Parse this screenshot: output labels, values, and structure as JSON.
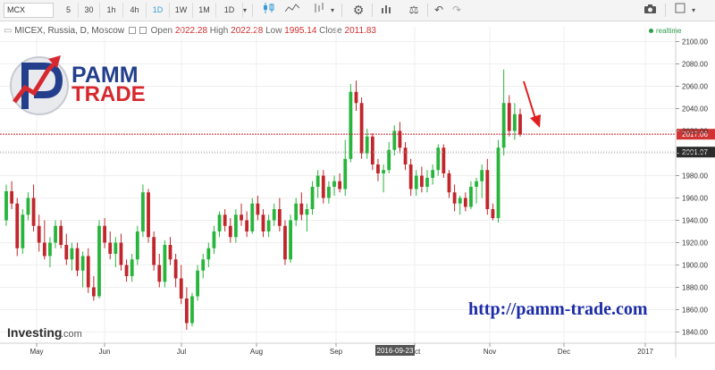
{
  "toolbar": {
    "symbol": "MCX",
    "intervals": [
      "5",
      "30",
      "1h",
      "4h",
      "1D",
      "1W",
      "1M"
    ],
    "active_interval": "1D",
    "range_select": "1D",
    "icons": [
      "candlestick-chart-icon",
      "area-chart-icon",
      "indicators-icon",
      "settings-icon",
      "bar-chart-icon",
      "scale-icon",
      "undo-icon",
      "redo-icon",
      "camera-icon",
      "fullscreen-icon"
    ]
  },
  "legend": {
    "title": "MICEX, Russia, D, Moscow",
    "open_label": "Open",
    "open": "2022.28",
    "high_label": "High",
    "high": "2022.28",
    "low_label": "Low",
    "low": "1995.14",
    "close_label": "Close",
    "close": "2011.83",
    "realtime": "realtime"
  },
  "branding": {
    "logo_line1": "PAMM",
    "logo_line2": "TRADE",
    "url": "http://pamm-trade.com",
    "watermark_a": "Investing",
    "watermark_b": ".com"
  },
  "colors": {
    "up": "#27b53b",
    "down": "#c0262b",
    "grid": "#efefef",
    "current_line": "#c0262b",
    "current_bg": "#d03434",
    "last_bg": "#2b2b2b",
    "url": "#1c2ba8",
    "logo_red": "#d7282f",
    "logo_blue": "#233f8c",
    "arrow": "#e02020"
  },
  "chart_data": {
    "type": "candlestick",
    "title": "MICEX, Russia, D, Moscow",
    "xlabel": "",
    "ylabel": "",
    "ylim": [
      1830,
      2102
    ],
    "y_ticks": [
      2100,
      2080,
      2060,
      2040,
      2020,
      2000,
      1980,
      1960,
      1940,
      1920,
      1900,
      1880,
      1860,
      1840
    ],
    "y_tick_labels": [
      "2100.00",
      "2080.00",
      "2060.00",
      "2040.00",
      "2020.00",
      "2000.00",
      "1980.00",
      "1960.00",
      "1940.00",
      "1920.00",
      "1900.00",
      "1880.00",
      "1860.00",
      "1840.00"
    ],
    "x_labels": [
      "May",
      "Jun",
      "Jul",
      "Aug",
      "Sep",
      "Oct",
      "Nov",
      "Dec",
      "2017"
    ],
    "crosshair_date": "2016-09-23",
    "price_tags": [
      {
        "label": "2017.06",
        "value": 2017.06,
        "kind": "current"
      },
      {
        "label": "2001.07",
        "value": 2001.07,
        "kind": "last"
      }
    ],
    "annotation": "downward arrow after early November spike",
    "grid": true,
    "candles": [
      [
        1940,
        1972,
        1935,
        1966
      ],
      [
        1966,
        1975,
        1950,
        1955
      ],
      [
        1955,
        1960,
        1908,
        1915
      ],
      [
        1915,
        1950,
        1910,
        1945
      ],
      [
        1945,
        1965,
        1940,
        1960
      ],
      [
        1960,
        1972,
        1930,
        1935
      ],
      [
        1935,
        1945,
        1912,
        1920
      ],
      [
        1920,
        1940,
        1905,
        1908
      ],
      [
        1908,
        1925,
        1898,
        1920
      ],
      [
        1920,
        1940,
        1915,
        1935
      ],
      [
        1935,
        1940,
        1915,
        1918
      ],
      [
        1918,
        1928,
        1900,
        1905
      ],
      [
        1905,
        1920,
        1895,
        1915
      ],
      [
        1915,
        1920,
        1890,
        1895
      ],
      [
        1895,
        1912,
        1880,
        1908
      ],
      [
        1908,
        1915,
        1875,
        1880
      ],
      [
        1880,
        1890,
        1868,
        1872
      ],
      [
        1872,
        1940,
        1870,
        1935
      ],
      [
        1935,
        1942,
        1915,
        1920
      ],
      [
        1920,
        1930,
        1905,
        1910
      ],
      [
        1910,
        1925,
        1898,
        1920
      ],
      [
        1920,
        1928,
        1895,
        1900
      ],
      [
        1900,
        1905,
        1885,
        1890
      ],
      [
        1890,
        1910,
        1885,
        1905
      ],
      [
        1905,
        1935,
        1900,
        1930
      ],
      [
        1930,
        1972,
        1925,
        1965
      ],
      [
        1965,
        1968,
        1920,
        1925
      ],
      [
        1925,
        1930,
        1895,
        1900
      ],
      [
        1900,
        1910,
        1880,
        1885
      ],
      [
        1885,
        1922,
        1880,
        1918
      ],
      [
        1918,
        1925,
        1900,
        1905
      ],
      [
        1905,
        1910,
        1880,
        1888
      ],
      [
        1888,
        1900,
        1865,
        1870
      ],
      [
        1870,
        1880,
        1842,
        1848
      ],
      [
        1848,
        1875,
        1845,
        1872
      ],
      [
        1872,
        1900,
        1868,
        1895
      ],
      [
        1895,
        1910,
        1888,
        1905
      ],
      [
        1905,
        1920,
        1898,
        1915
      ],
      [
        1915,
        1935,
        1910,
        1930
      ],
      [
        1930,
        1948,
        1925,
        1945
      ],
      [
        1945,
        1950,
        1930,
        1935
      ],
      [
        1935,
        1942,
        1920,
        1925
      ],
      [
        1925,
        1950,
        1920,
        1945
      ],
      [
        1945,
        1955,
        1935,
        1940
      ],
      [
        1940,
        1948,
        1925,
        1930
      ],
      [
        1930,
        1960,
        1928,
        1955
      ],
      [
        1955,
        1962,
        1940,
        1945
      ],
      [
        1945,
        1950,
        1925,
        1930
      ],
      [
        1930,
        1945,
        1925,
        1940
      ],
      [
        1940,
        1955,
        1935,
        1950
      ],
      [
        1950,
        1960,
        1930,
        1935
      ],
      [
        1935,
        1940,
        1900,
        1905
      ],
      [
        1905,
        1945,
        1902,
        1940
      ],
      [
        1940,
        1960,
        1935,
        1955
      ],
      [
        1955,
        1965,
        1940,
        1945
      ],
      [
        1945,
        1955,
        1930,
        1950
      ],
      [
        1950,
        1975,
        1945,
        1970
      ],
      [
        1970,
        1985,
        1960,
        1980
      ],
      [
        1980,
        1985,
        1955,
        1960
      ],
      [
        1960,
        1975,
        1955,
        1970
      ],
      [
        1970,
        1980,
        1962,
        1975
      ],
      [
        1975,
        1982,
        1965,
        1968
      ],
      [
        1968,
        2012,
        1962,
        1995
      ],
      [
        1995,
        2062,
        1992,
        2055
      ],
      [
        2055,
        2065,
        2038,
        2045
      ],
      [
        2045,
        2050,
        1995,
        2000
      ],
      [
        2000,
        2022,
        1995,
        2015
      ],
      [
        2015,
        2018,
        1985,
        1990
      ],
      [
        1990,
        1995,
        1975,
        1982
      ],
      [
        1982,
        1990,
        1965,
        1985
      ],
      [
        1985,
        2010,
        1982,
        2003
      ],
      [
        2003,
        2025,
        1998,
        2020
      ],
      [
        2020,
        2028,
        2000,
        2005
      ],
      [
        2005,
        2010,
        1985,
        1990
      ],
      [
        1990,
        1995,
        1962,
        1968
      ],
      [
        1968,
        1985,
        1962,
        1980
      ],
      [
        1980,
        1988,
        1965,
        1970
      ],
      [
        1970,
        1985,
        1965,
        1978
      ],
      [
        1978,
        1990,
        1972,
        1985
      ],
      [
        1985,
        2008,
        1980,
        2005
      ],
      [
        2005,
        2008,
        1978,
        1982
      ],
      [
        1982,
        1985,
        1960,
        1965
      ],
      [
        1965,
        1972,
        1948,
        1955
      ],
      [
        1955,
        1962,
        1945,
        1960
      ],
      [
        1960,
        1965,
        1948,
        1952
      ],
      [
        1952,
        1975,
        1950,
        1970
      ],
      [
        1970,
        1978,
        1955,
        1975
      ],
      [
        1975,
        1990,
        1960,
        1985
      ],
      [
        1985,
        1995,
        1945,
        1950
      ],
      [
        1950,
        1955,
        1940,
        1942
      ],
      [
        1942,
        2012,
        1938,
        2005
      ],
      [
        2005,
        2075,
        1998,
        2045
      ],
      [
        2045,
        2052,
        2015,
        2020
      ],
      [
        2020,
        2045,
        2012,
        2035
      ],
      [
        2035,
        2040,
        2015,
        2017
      ]
    ]
  }
}
